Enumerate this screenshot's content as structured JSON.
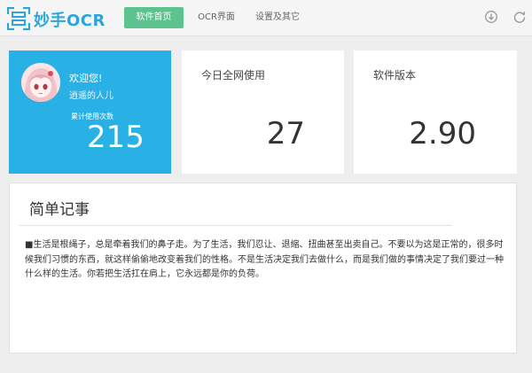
{
  "app": {
    "title": "妙手OCR"
  },
  "nav": {
    "tabs": [
      {
        "label": "软件首页",
        "active": true
      },
      {
        "label": "OCR界面",
        "active": false
      },
      {
        "label": "设置及其它",
        "active": false
      }
    ]
  },
  "toolbar": {
    "icons": [
      "download-icon",
      "refresh-icon"
    ]
  },
  "user_card": {
    "welcome": "欢迎您!",
    "username": "逍遥的人儿",
    "count_label": "累计使用次数",
    "count_value": "215"
  },
  "today_card": {
    "label": "今日全网使用",
    "value": "27"
  },
  "version_card": {
    "label": "软件版本",
    "value": "2.90"
  },
  "note": {
    "title": "简单记事",
    "body": "■生活是根绳子，总是牵着我们的鼻子走。为了生活，我们忍让、退缩、扭曲甚至出卖自己。不要以为这是正常的，很多时候我们习惯的东西，就这样偷偷地改变着我们的性格。不是生活决定我们去做什么，而是我们做的事情决定了我们要过一种什么样的生活。你若把生活扛在肩上，它永远都是你的负荷。"
  },
  "colors": {
    "accent_green": "#5cc38f",
    "accent_blue": "#29b1e5",
    "logo_blue": "#2aa6dd"
  }
}
